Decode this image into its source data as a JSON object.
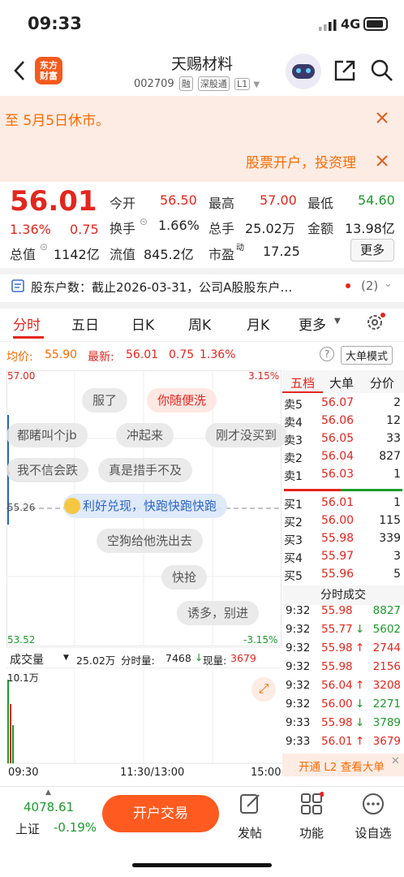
{
  "status": {
    "time": "09:33",
    "network": "4G"
  },
  "header": {
    "logo_line1": "东方",
    "logo_line2": "财富",
    "title": "天赐材料",
    "code": "002709",
    "tags": [
      "融",
      "深股通",
      "L1"
    ]
  },
  "banner": {
    "notice": "至 5月5日休市。",
    "ad": "股票开户，投资理"
  },
  "quote": {
    "price": "56.01",
    "change_pct": "1.36%",
    "change": "0.75",
    "open_label": "今开",
    "open": "56.50",
    "high_label": "最高",
    "high": "57.00",
    "low_label": "最低",
    "low": "54.60",
    "turnover_label": "换手",
    "turnover": "1.66%",
    "volume_label": "总手",
    "volume": "25.02万",
    "amount_label": "金额",
    "amount": "13.98亿",
    "mcap_label": "总值",
    "mcap": "1142亿",
    "float_label": "流值",
    "float": "845.2亿",
    "pe_label": "市盈",
    "pe_sup": "动",
    "pe": "17.25",
    "more_label": "更多"
  },
  "shareholder": {
    "text": "股东户数：截止2026-03-31，公司A股股东户…",
    "count": "(2)"
  },
  "tabs": [
    "分时",
    "五日",
    "日K",
    "周K",
    "月K",
    "更多"
  ],
  "avgline": {
    "avg_label": "均价:",
    "avg": "55.90",
    "last_label": "最新:",
    "last": "56.01",
    "chg": "0.75",
    "pct": "1.36%",
    "bigorder": "大单模式"
  },
  "chart": {
    "top_price": "57.00",
    "bottom_price": "53.52",
    "top_pct": "3.15%",
    "bottom_pct": "-3.15%",
    "mid_price": "55.26",
    "x_start": "09:30",
    "x_mid": "11:30/13:00",
    "x_end": "15:00"
  },
  "danmaku": [
    "服了",
    "你随便洗",
    "都睹叫个jb",
    "冲起来",
    "刚才没买到",
    "我不信会跌",
    "真是措手不及",
    "利好兑现，快跑快跑快跑",
    "空狗给他洗出去",
    "快抢",
    "诱多，别进"
  ],
  "volume_bar": {
    "label": "成交量",
    "total": "25.02万",
    "min_label": "分时量:",
    "min": "7468",
    "now_label": "现量:",
    "now": "3679",
    "axis": "10.1万"
  },
  "orderbook": {
    "tabs": [
      "五档",
      "大单",
      "分价"
    ],
    "sells": [
      {
        "label": "卖5",
        "price": "56.07",
        "qty": "2"
      },
      {
        "label": "卖4",
        "price": "56.06",
        "qty": "12"
      },
      {
        "label": "卖3",
        "price": "56.05",
        "qty": "33"
      },
      {
        "label": "卖2",
        "price": "56.04",
        "qty": "827"
      },
      {
        "label": "卖1",
        "price": "56.03",
        "qty": "1"
      }
    ],
    "buys": [
      {
        "label": "买1",
        "price": "56.01",
        "qty": "1"
      },
      {
        "label": "买2",
        "price": "56.00",
        "qty": "115"
      },
      {
        "label": "买3",
        "price": "55.98",
        "qty": "339"
      },
      {
        "label": "买4",
        "price": "55.97",
        "qty": "3"
      },
      {
        "label": "买5",
        "price": "55.96",
        "qty": "5"
      }
    ]
  },
  "ticks": {
    "title": "分时成交",
    "rows": [
      {
        "t": "9:32",
        "p": "55.98",
        "arrow": "",
        "q": "8827"
      },
      {
        "t": "9:32",
        "p": "55.77",
        "arrow": "↓",
        "q": "5602"
      },
      {
        "t": "9:32",
        "p": "55.98",
        "arrow": "↑",
        "q": "2744"
      },
      {
        "t": "9:32",
        "p": "55.98",
        "arrow": "",
        "q": "2156"
      },
      {
        "t": "9:32",
        "p": "56.04",
        "arrow": "↑",
        "q": "3208"
      },
      {
        "t": "9:32",
        "p": "56.00",
        "arrow": "↓",
        "q": "2271"
      },
      {
        "t": "9:33",
        "p": "55.98",
        "arrow": "↓",
        "q": "3789"
      },
      {
        "t": "9:33",
        "p": "56.01",
        "arrow": "↑",
        "q": "3679"
      }
    ],
    "l2": "开通 L2 查看大单"
  },
  "bottom": {
    "index_value": "4078.61",
    "index_name": "上证",
    "index_pct": "-0.19%",
    "trade_label": "开户交易",
    "post_label": "发帖",
    "func_label": "功能",
    "settings_label": "设自选"
  },
  "colors": {
    "up": "#e3261e",
    "down": "#1c9b2c",
    "accent": "#ff5a1f"
  }
}
